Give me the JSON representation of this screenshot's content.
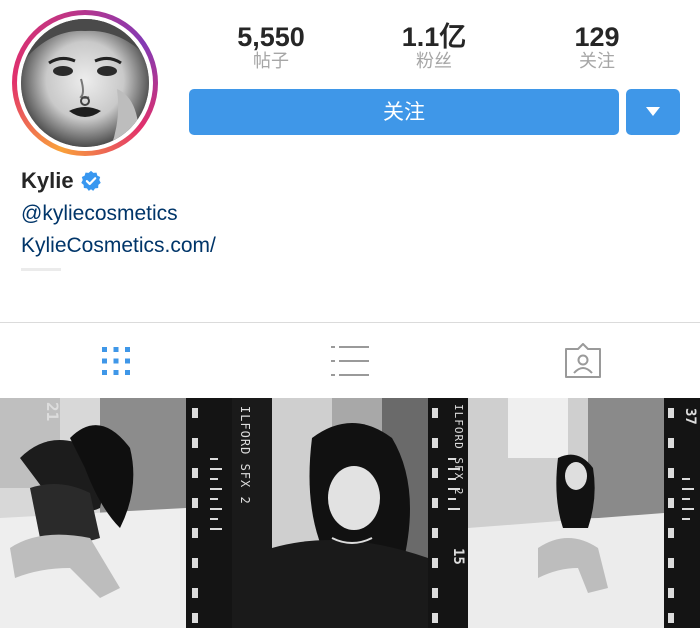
{
  "profile": {
    "name": "Kylie",
    "handle": "@kyliecosmetics",
    "website": "KylieCosmetics.com/"
  },
  "stats": [
    {
      "value": "5,550",
      "label": "帖子"
    },
    {
      "value": "1.1亿",
      "label": "粉丝"
    },
    {
      "value": "129",
      "label": "关注"
    }
  ],
  "actions": {
    "follow_label": "关注"
  },
  "tabs": [
    {
      "icon": "grid-icon",
      "active": true
    },
    {
      "icon": "list-icon",
      "active": false
    },
    {
      "icon": "tagged-icon",
      "active": false
    }
  ],
  "film_labels": {
    "strip1_top": "ILFORD SFX 2",
    "strip1_num": "21",
    "strip2_top": "ILFORD SFX 2",
    "strip2_num": "15",
    "strip3_num": "37"
  },
  "colors": {
    "accent": "#3f97e8",
    "link": "#003569",
    "active_tab": "#3f97e8",
    "inactive_tab": "#9a9a9a",
    "verified": "#3897f0"
  }
}
